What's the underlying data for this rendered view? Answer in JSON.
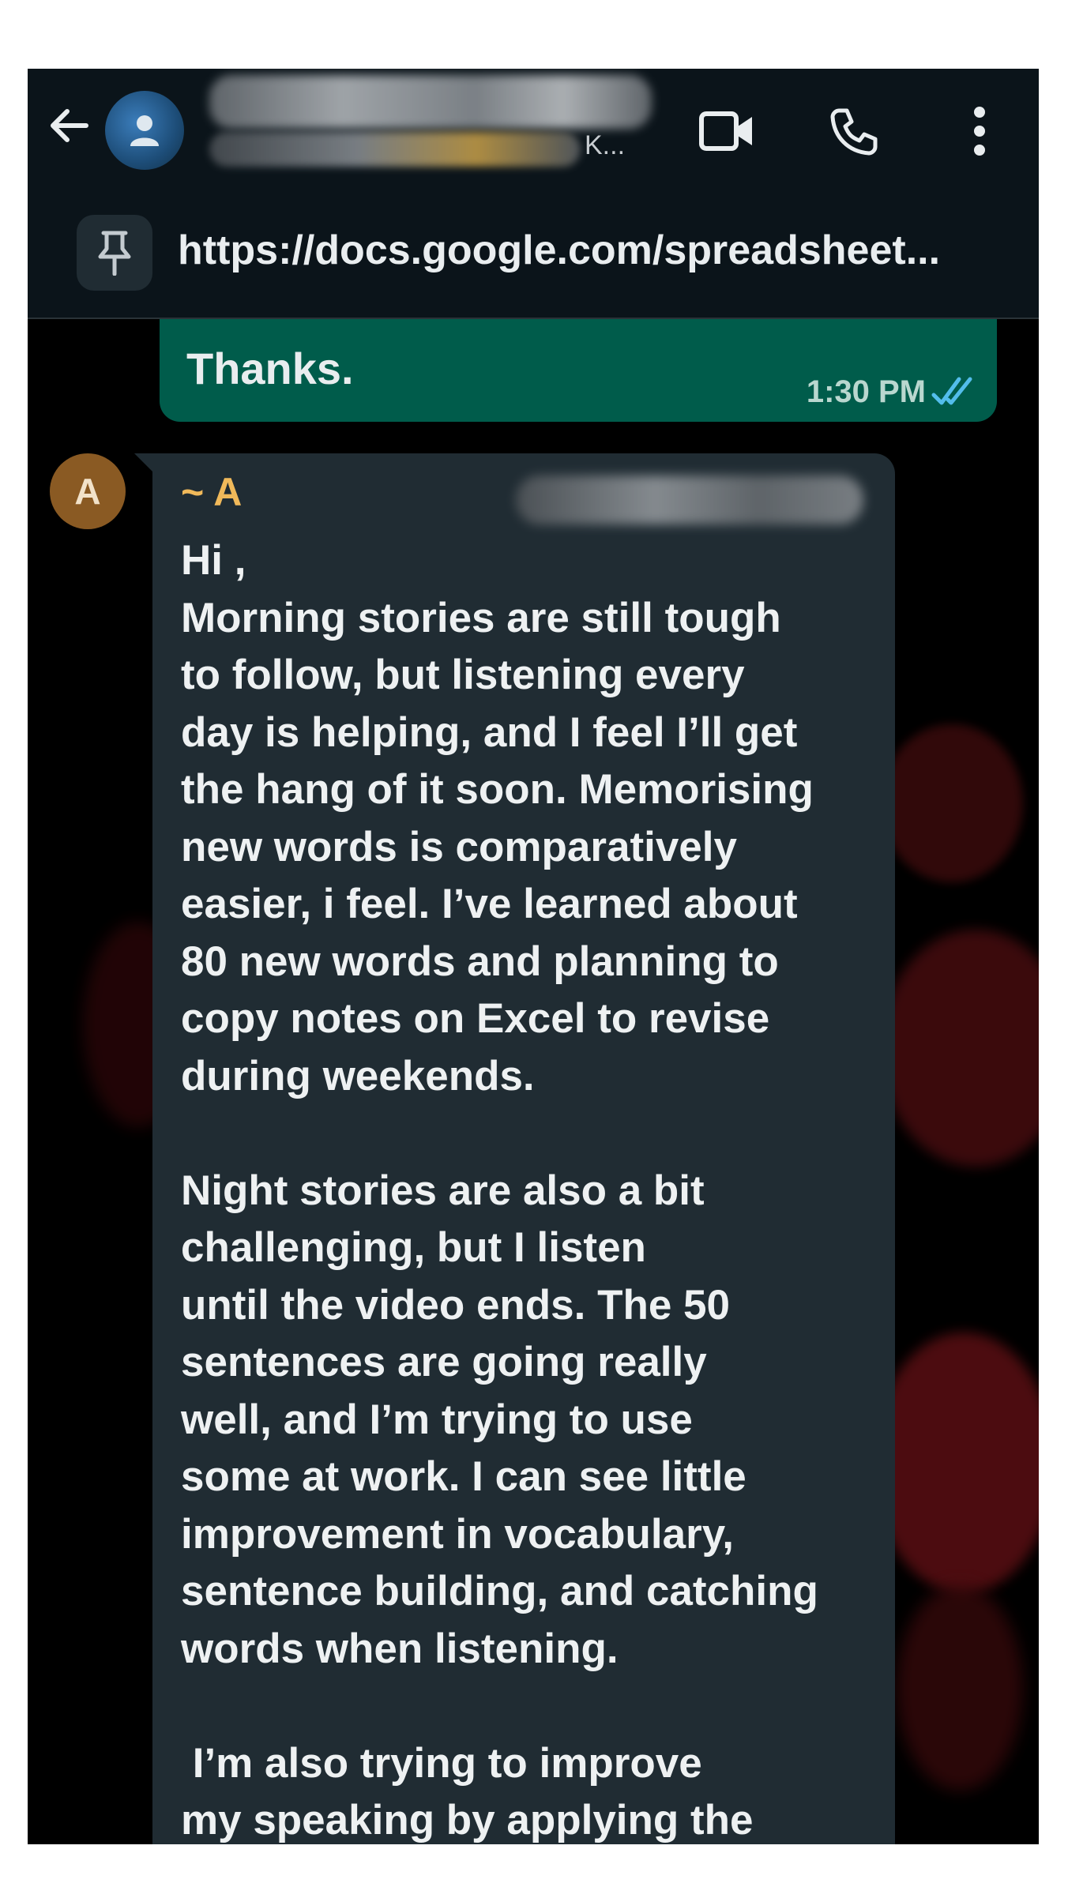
{
  "header": {
    "subtitle_suffix": "K...",
    "icons": [
      "back-arrow-icon",
      "group-avatar-icon",
      "video-call-icon",
      "phone-call-icon",
      "more-vert-icon"
    ]
  },
  "pinned": {
    "icon": "pin-icon",
    "text": "https://docs.google.com/spreadsheet..."
  },
  "outgoing": {
    "text": "Thanks.",
    "time": "1:30 PM",
    "status_icon": "double-check-icon",
    "status_color": "#53bdeb"
  },
  "incoming": {
    "avatar_letter": "A",
    "avatar_color": "#8a5a23",
    "sender": "~ A",
    "sender_color": "#f0b95a",
    "lines": [
      "Hi ,",
      "Morning stories are still tough",
      "to follow, but listening every",
      "day is helping, and I feel I’ll get",
      "the hang of it soon. Memorising",
      "new words is comparatively",
      "easier, i feel. I’ve learned about",
      "80 new words and planning to",
      "copy notes on Excel to revise",
      "during weekends.",
      "",
      "Night stories are also a bit",
      "challenging, but I listen",
      "until the video ends. The 50",
      "sentences are going really",
      "well, and I’m trying to use",
      "some at work. I can see little",
      "improvement in vocabulary,",
      "sentence building, and catching",
      "words when listening.",
      "",
      " I’m also trying to improve",
      "my speaking by applying the"
    ]
  },
  "colors": {
    "header_bg": "#0b141a",
    "outgoing_bg": "#005c4b",
    "incoming_bg": "#202c33",
    "chat_bg": "#000000"
  }
}
